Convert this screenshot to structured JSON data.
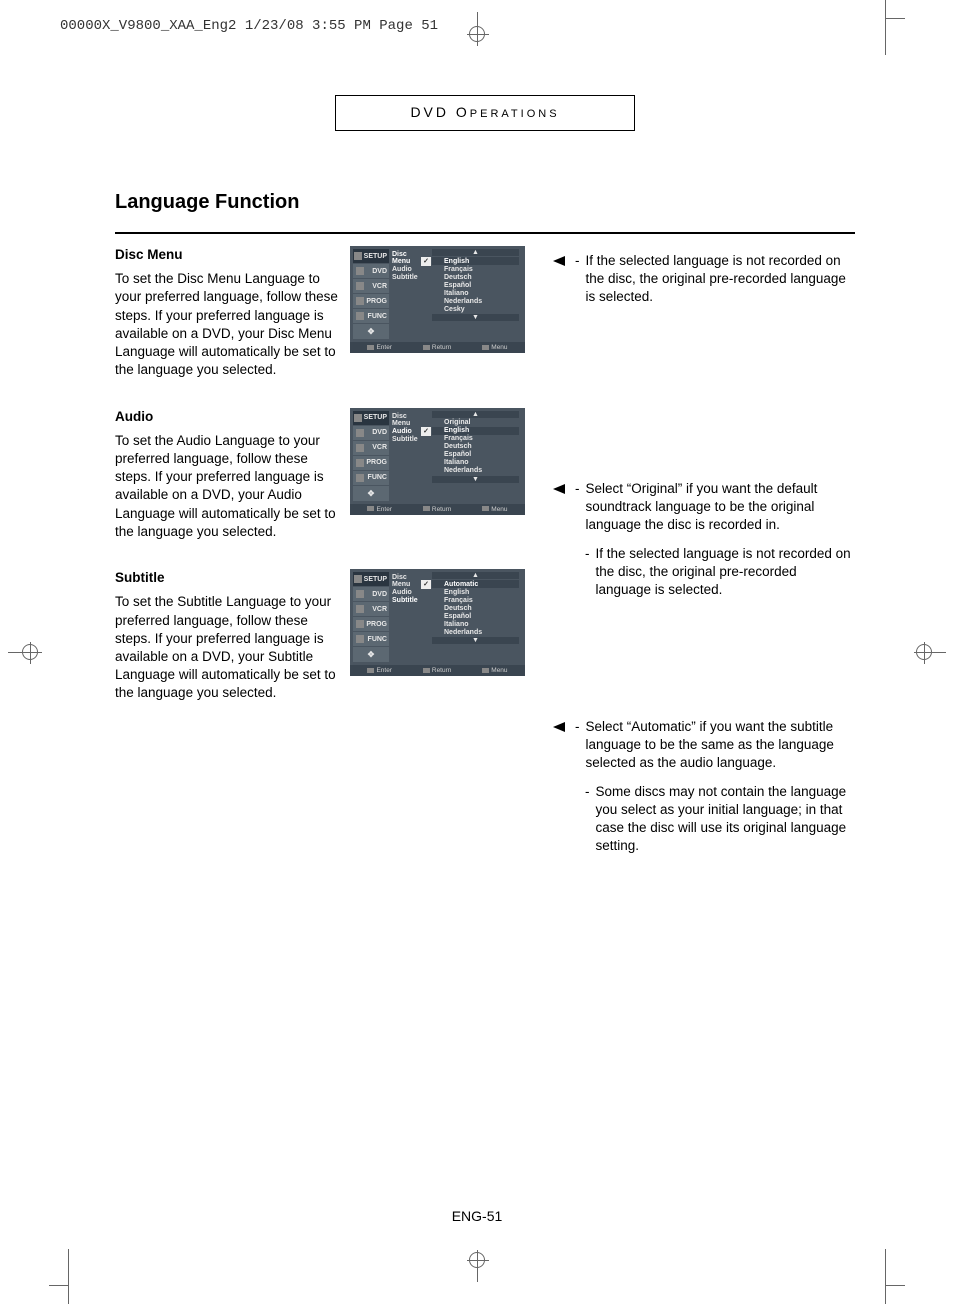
{
  "slug": "00000X_V9800_XAA_Eng2  1/23/08  3:55 PM  Page 51",
  "section_label": "DVD OPERATIONS",
  "heading": "Language Function",
  "page_number": "ENG-51",
  "left_tabs": [
    "SETUP",
    "DVD",
    "VCR",
    "PROG",
    "FUNC"
  ],
  "mid_items": [
    "Disc Menu",
    "Audio",
    "Subtitle"
  ],
  "footer": {
    "enter": "Enter",
    "return": "Return",
    "menu": "Menu"
  },
  "disc_menu": {
    "title": "Disc Menu",
    "body": "To set the Disc Menu Language to your preferred language, follow these steps. If your preferred language is available on a DVD, your Disc Menu Language will automatically be set to the language you selected.",
    "selected_mid": 0,
    "options": [
      "English",
      "Français",
      "Deutsch",
      "Español",
      "Italiano",
      "Nederlands",
      "Cesky"
    ],
    "selected_option": 0,
    "note1": "If the selected language is not recorded on the disc, the original pre-recorded language is selected."
  },
  "audio": {
    "title": "Audio",
    "body": "To set the Audio Language to your preferred language, follow these steps. If your preferred language is available on a DVD, your Audio Language will automatically be set to the language you selected.",
    "selected_mid": 1,
    "options": [
      "Original",
      "English",
      "Français",
      "Deutsch",
      "Español",
      "Italiano",
      "Nederlands"
    ],
    "selected_option": 1,
    "note1": "Select “Original” if you want the default soundtrack language to be the original language the disc is recorded in.",
    "note2": "If the selected language is not recorded on the disc, the original pre-recorded language is selected."
  },
  "subtitle": {
    "title": "Subtitle",
    "body": "To set the Subtitle Language to your preferred language, follow these steps. If your preferred language is available on a DVD, your Subtitle Language will automatically be set to the language you selected.",
    "selected_mid": 2,
    "options": [
      "Automatic",
      "English",
      "Français",
      "Deutsch",
      "Español",
      "Italiano",
      "Nederlands"
    ],
    "selected_option": 0,
    "note1": "Select “Automatic” if you want the subtitle language to be the same as the language selected as the audio language.",
    "note2": "Some discs may not contain the language you select as your initial language; in that case the disc will use its original  language setting."
  }
}
